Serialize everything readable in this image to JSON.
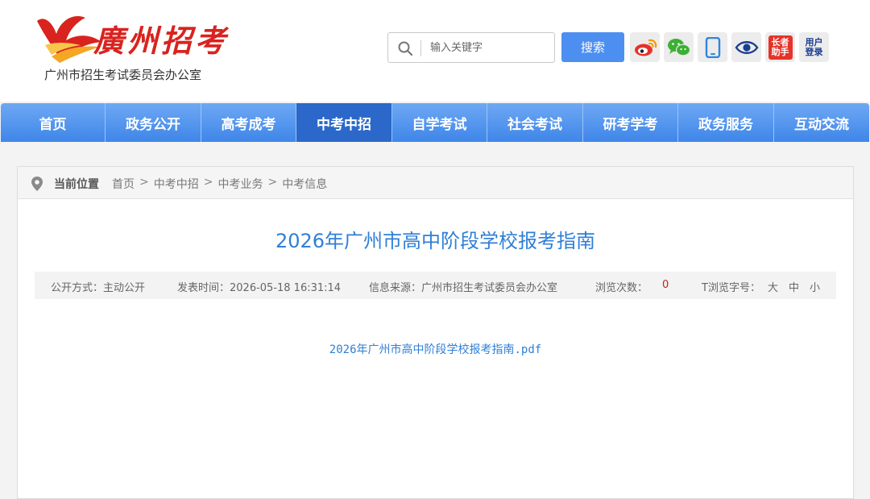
{
  "header": {
    "logo_title": "廣州招考",
    "logo_subtitle": "广州市招生考试委员会办公室",
    "search_placeholder": "输入关键字",
    "search_button": "搜索",
    "assistant_label_1": "长者",
    "assistant_label_2": "助手",
    "login_label_1": "用户",
    "login_label_2": "登录"
  },
  "nav": {
    "items": [
      {
        "label": "首页"
      },
      {
        "label": "政务公开"
      },
      {
        "label": "高考成考"
      },
      {
        "label": "中考中招"
      },
      {
        "label": "自学考试"
      },
      {
        "label": "社会考试"
      },
      {
        "label": "研考学考"
      },
      {
        "label": "政务服务"
      },
      {
        "label": "互动交流"
      }
    ],
    "active_index": 3
  },
  "breadcrumb": {
    "label": "当前位置",
    "path": [
      "首页",
      "中考中招",
      "中考业务",
      "中考信息"
    ],
    "separator": ">"
  },
  "article": {
    "title": "2026年广州市高中阶段学校报考指南",
    "meta": {
      "disclosure": "公开方式：主动公开",
      "publish_time": "发表时间：2026-05-18 16:31:14",
      "source": "信息来源：广州市招生考试委员会办公室",
      "views_label": "浏览次数：",
      "views_count": "0",
      "font_size_label": "T浏览字号：",
      "font_large": "大",
      "font_medium": "中",
      "font_small": "小"
    },
    "attachment": "2026年广州市高中阶段学校报考指南.pdf"
  },
  "colors": {
    "brand_red": "#d9231f",
    "nav_blue": "#4d8ff0",
    "nav_active": "#2b68c9",
    "link_blue": "#2f7fd6",
    "views_red": "#c0251c"
  },
  "icons": [
    "logo-flower-icon",
    "search-icon",
    "weibo-icon",
    "wechat-icon",
    "mobile-icon",
    "eye-icon",
    "location-pin-icon"
  ]
}
